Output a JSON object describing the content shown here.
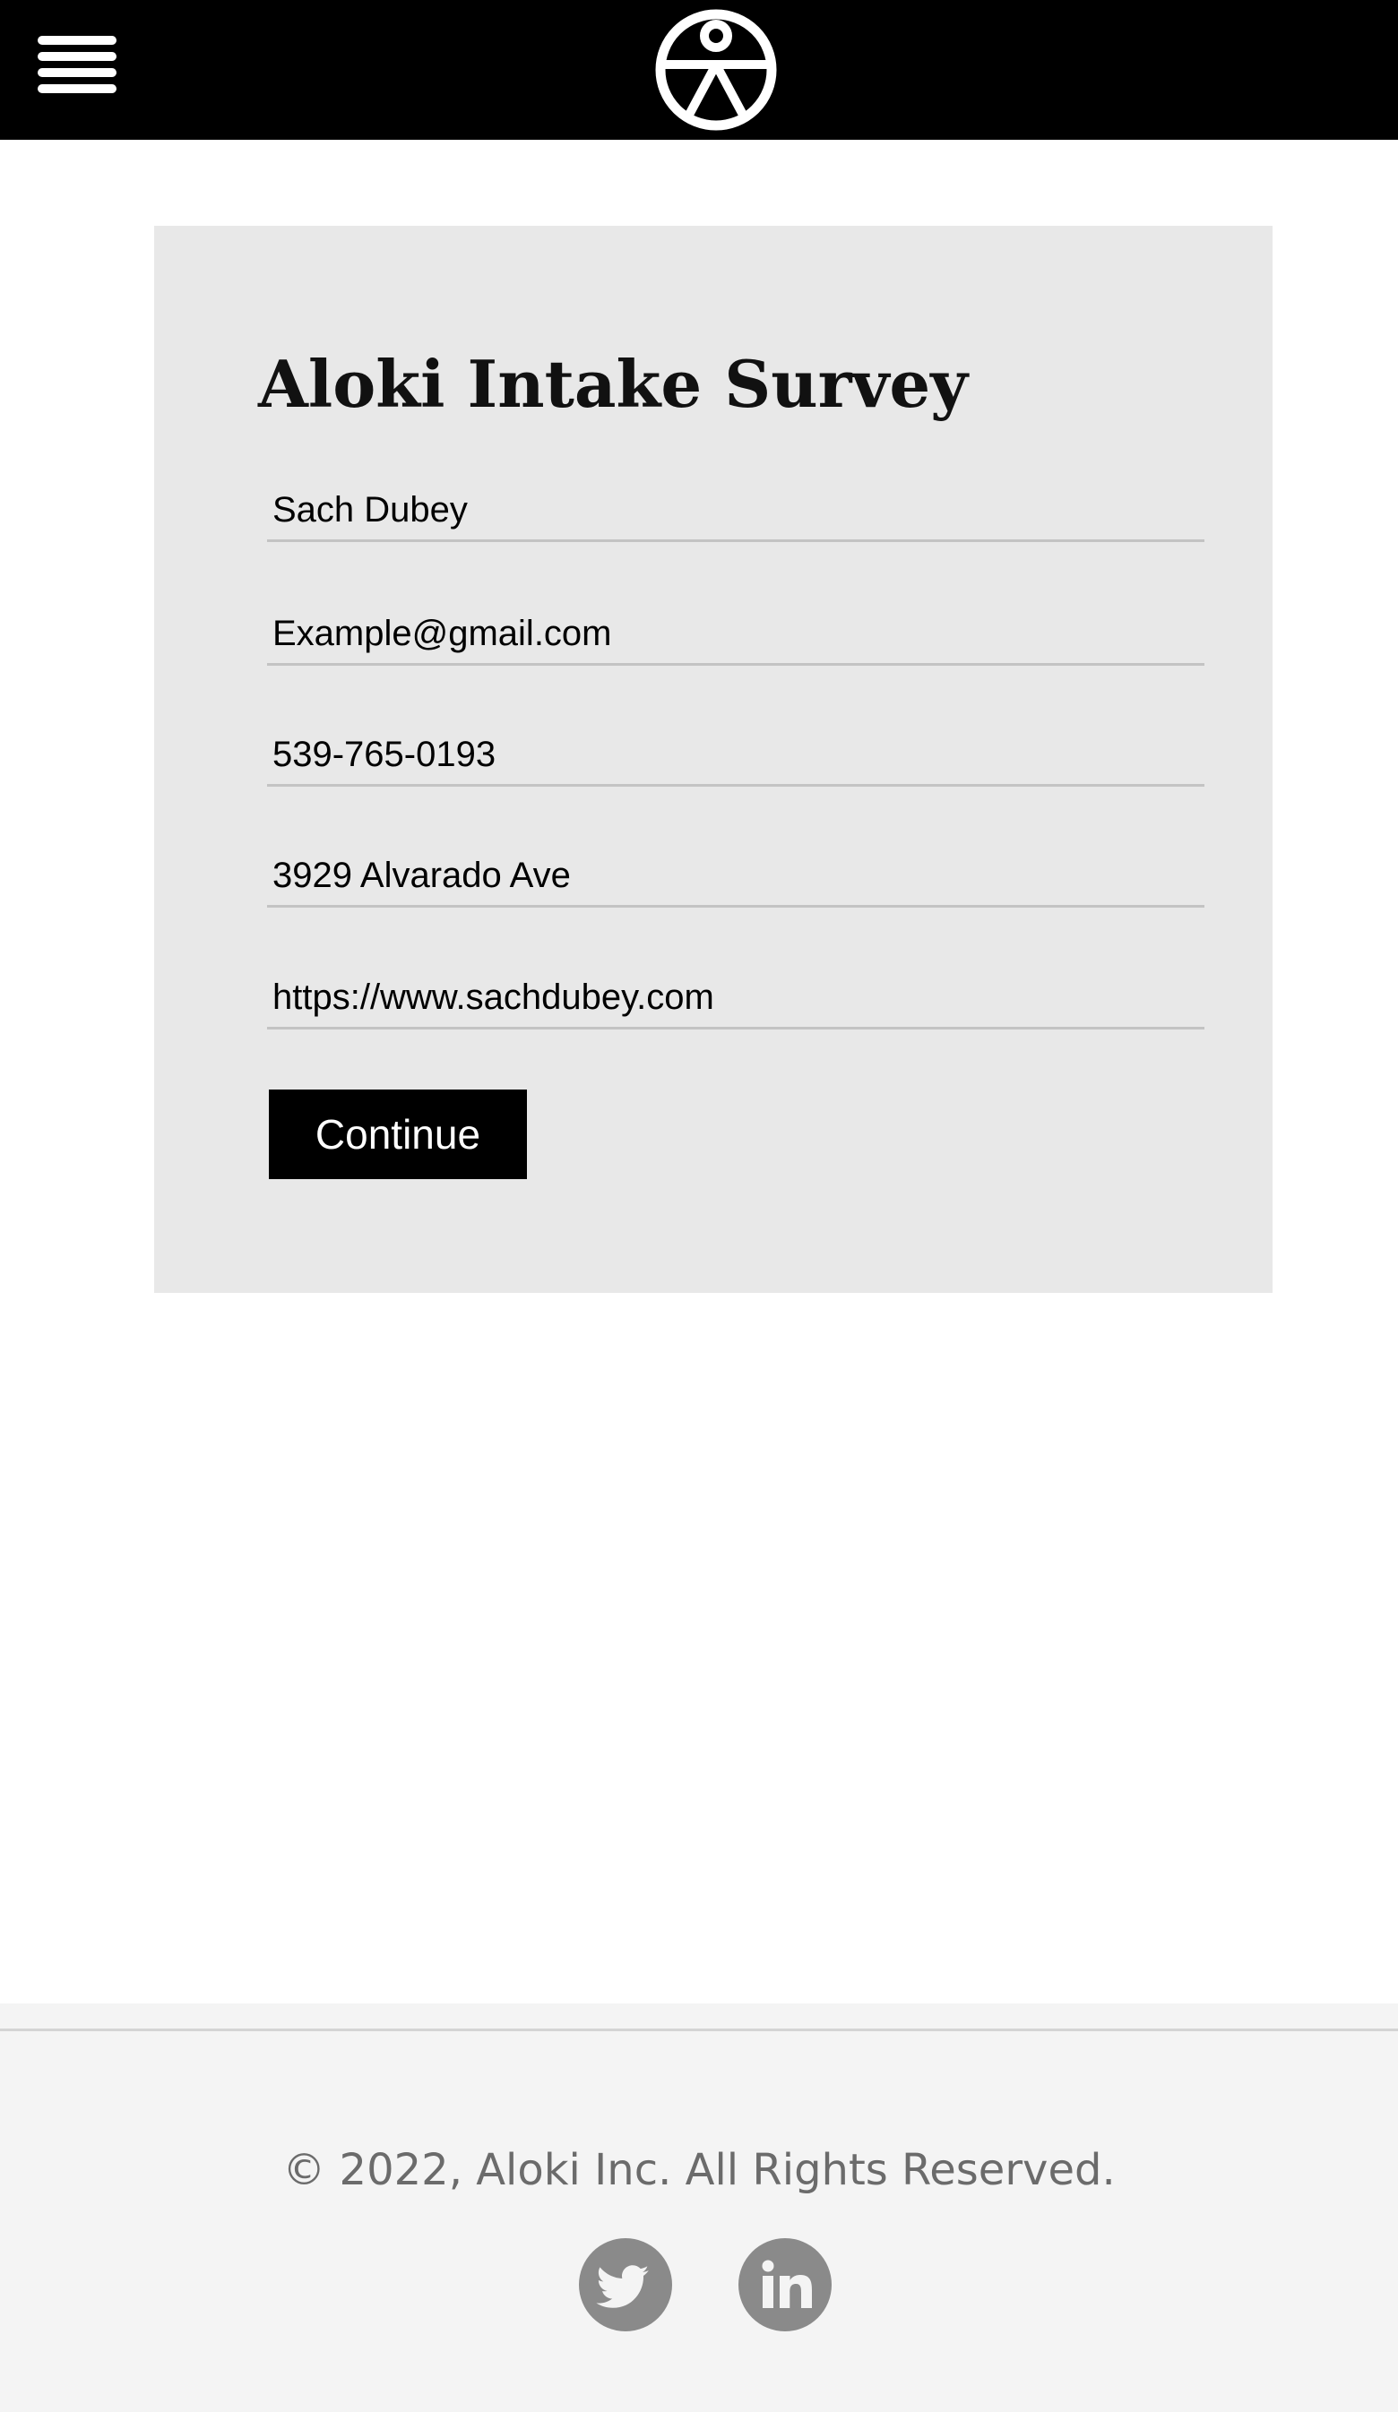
{
  "header": {
    "menu_icon": "hamburger-menu-icon",
    "logo_icon": "aloki-person-logo-icon",
    "background_color": "#000000"
  },
  "form": {
    "title": "Aloki Intake Survey",
    "fields": {
      "name": {
        "value": "Sach Dubey"
      },
      "email": {
        "value": "Example@gmail.com"
      },
      "phone": {
        "value": "539-765-0193"
      },
      "address": {
        "value": "3929 Alvarado Ave"
      },
      "website": {
        "value": "https://www.sachdubey.com"
      }
    },
    "continue_label": "Continue",
    "card_color": "#e8e8e8"
  },
  "footer": {
    "copyright": "© 2022, Aloki Inc. All Rights Reserved.",
    "social": [
      {
        "name": "twitter",
        "icon": "twitter-icon"
      },
      {
        "name": "linkedin",
        "icon": "linkedin-icon"
      }
    ],
    "background_color": "#f4f4f4"
  }
}
